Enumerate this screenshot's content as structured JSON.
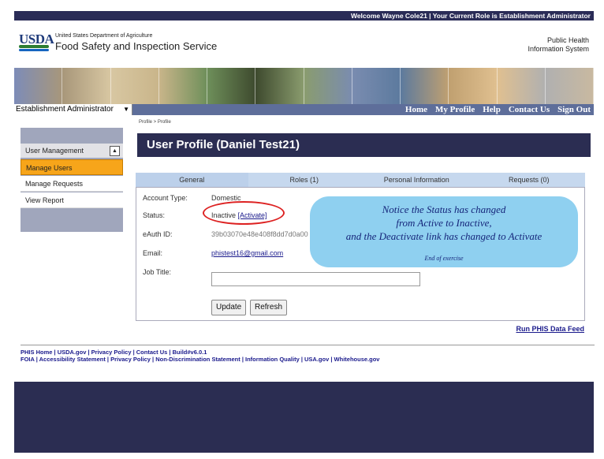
{
  "topbar": {
    "welcome_text": "Welcome Wayne Cole21 | Your Current Role is Establishment Administrator"
  },
  "header": {
    "logo_text": "USDA",
    "department": "United States Department of Agriculture",
    "agency": "Food Safety and Inspection Service",
    "system_line1": "Public Health",
    "system_line2": "Information System"
  },
  "nav": {
    "role_selected": "Establishment Administrator",
    "links": [
      "Home",
      "My Profile",
      "Help",
      "Contact Us",
      "Sign Out"
    ]
  },
  "breadcrumb": "Profile > Profile",
  "sidebar": {
    "section_label": "User Management",
    "items": [
      "Manage Users",
      "Manage Requests",
      "View Report"
    ],
    "active_item": "Manage Users"
  },
  "page_title": "User Profile (Daniel Test21)",
  "tabs": [
    "General",
    "Roles (1)",
    "Personal Information",
    "Requests (0)"
  ],
  "profile": {
    "account_type_label": "Account Type:",
    "account_type_value": "Domestic",
    "status_label": "Status:",
    "status_value": "Inactive",
    "activate_link": "[Activate]",
    "eauth_label": "eAuth ID:",
    "eauth_value": "39b03070e48e408f8dd7d0a00",
    "email_label": "Email:",
    "email_value": "phistest16@gmail.com",
    "job_title_label": "Job Title:",
    "job_title_value": ""
  },
  "buttons": {
    "update": "Update",
    "refresh": "Refresh"
  },
  "callout": {
    "line1": "Notice the Status has changed",
    "line2": "from Active to Inactive,",
    "line3": "and the Deactivate link has changed to Activate",
    "end_note": "End of exercise"
  },
  "data_feed_link": "Run PHIS Data Feed",
  "footer": {
    "line1": "PHIS Home | USDA.gov | Privacy Policy | Contact Us | Build#v6.0.1",
    "line2": "FOIA | Accessibility Statement | Privacy Policy | Non-Discrimination Statement | Information Quality | USA.gov | Whitehouse.gov"
  }
}
